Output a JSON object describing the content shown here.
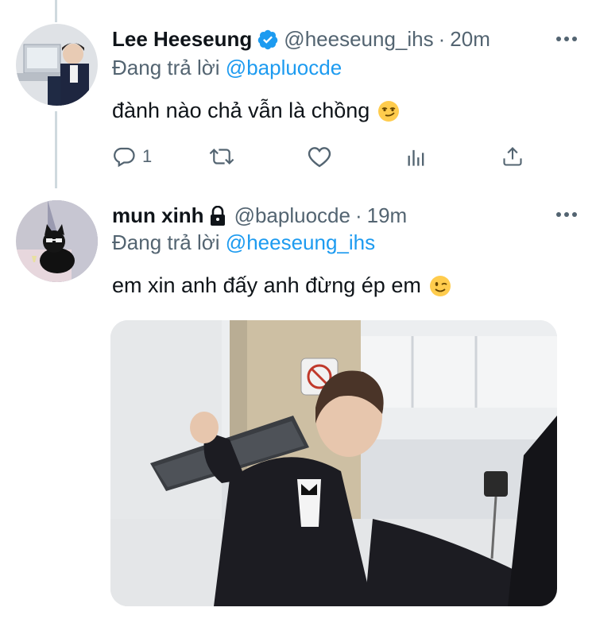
{
  "tweets": [
    {
      "name": "Lee Heeseung",
      "verified": true,
      "handle": "@heeseung_ihs",
      "separator": "·",
      "time": "20m",
      "replying_prefix": "Đang trả lời",
      "replying_to": "@bapluocde",
      "text": "đành nào chả vẫn là chồng",
      "emoji": "smirking-face",
      "reply_count": "1"
    },
    {
      "name": "mun xinh",
      "protected": true,
      "handle": "@bapluocde",
      "separator": "·",
      "time": "19m",
      "replying_prefix": "Đang trả lời",
      "replying_to": "@heeseung_ihs",
      "text": "em xin anh đấy anh đừng ép em",
      "emoji": "winking-face",
      "has_media": true
    }
  ],
  "colors": {
    "accent": "#1d9bf0",
    "secondary_text": "#536471",
    "thread_line": "#cfd9de"
  }
}
